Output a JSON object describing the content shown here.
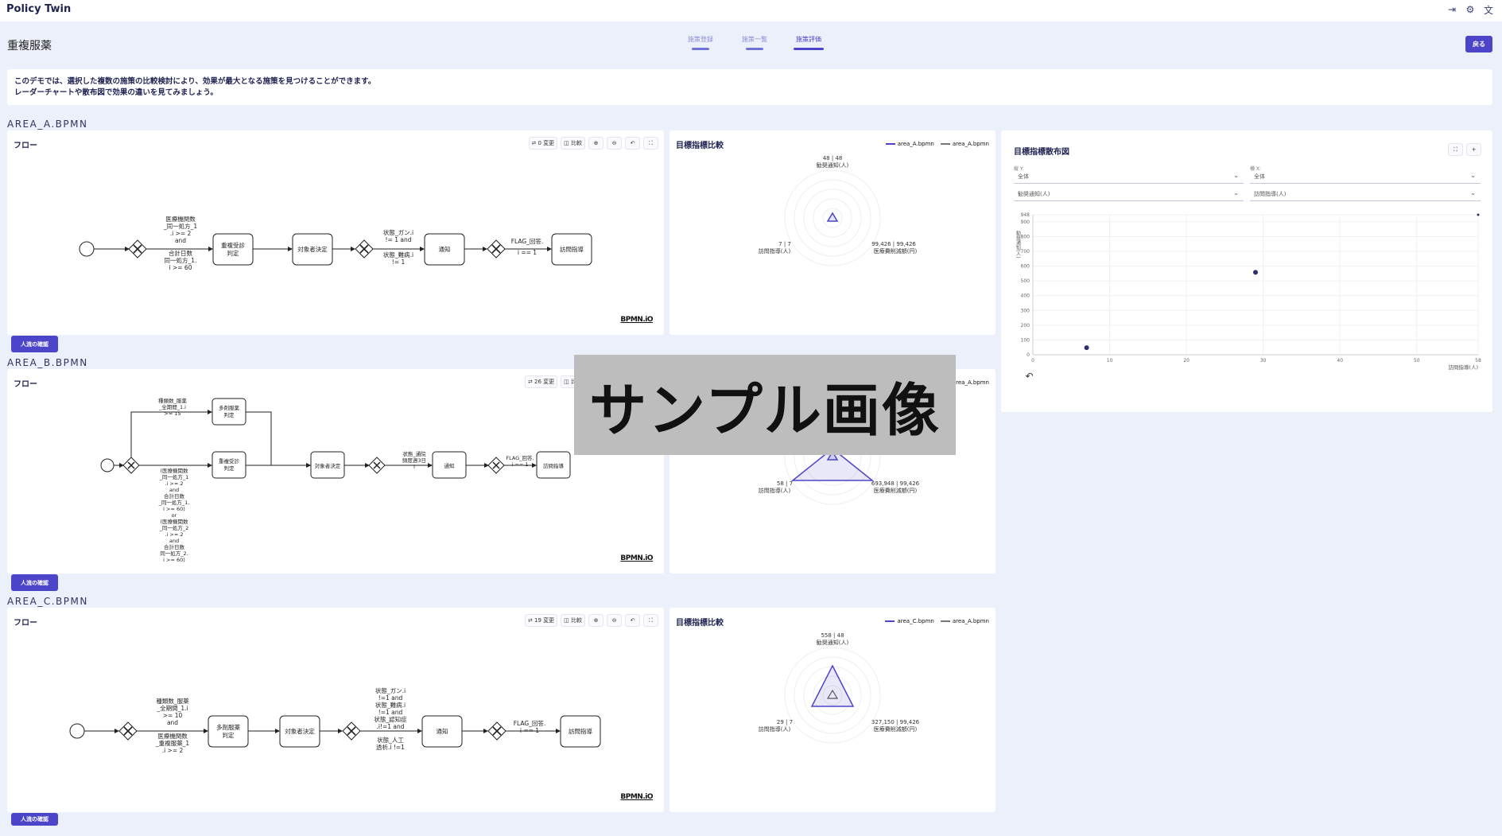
{
  "app": {
    "title": "Policy Twin"
  },
  "page": {
    "title": "重複服薬",
    "back_label": "戻る"
  },
  "steps": [
    {
      "label": "施策登録",
      "active": false
    },
    {
      "label": "施策一覧",
      "active": false
    },
    {
      "label": "施策評価",
      "active": true
    }
  ],
  "info": {
    "line1": "このデモでは、選択した複数の施策の比較検討により、効果が最大となる施策を見つけることができます。",
    "line2": "レーダーチャートや散布図で効果の違いを見てみましょう。"
  },
  "common": {
    "flow_title": "フロー",
    "compare_label": "比較",
    "bpmn_logo": "BPMN.iO",
    "check_button": "人流の確認",
    "radar_title": "目標指標比較",
    "scatter_title": "目標指標散布図"
  },
  "sections": [
    {
      "label": "AREA_A.BPMN",
      "change_count": "0 変更",
      "legend": [
        "area_A.bpmn",
        "area_A.bpmn"
      ],
      "radar": {
        "top": "48 | 48",
        "top_label": "勧奨通知(人)",
        "left": "7 | 7",
        "left_label": "訪問指導(人)",
        "right": "99,426 | 99,426",
        "right_label": "医療費削減額(円)"
      },
      "flow": {
        "gateway_cond1": [
          "医療機関数",
          "_同一処方_1",
          ".i >= 2",
          "and",
          "合計日数",
          "同一処方_1.",
          "i >= 60"
        ],
        "task1": [
          "重複受診",
          "判定"
        ],
        "task2": "対象者決定",
        "gateway_cond2": [
          "状態_ガン.i",
          "!= 1 and",
          "状態_難病.i",
          "!= 1"
        ],
        "task3": "通知",
        "gateway_cond3": [
          "FLAG_回答.",
          "i == 1"
        ],
        "task4": "訪問指導"
      }
    },
    {
      "label": "AREA_B.BPMN",
      "change_count": "26 変更",
      "legend": [
        "area_A.bpmn"
      ],
      "radar": {
        "left": "58 | 7",
        "left_label": "訪問指導(人)",
        "right": "693,948 | 99,426",
        "right_label": "医療費削減額(円)"
      },
      "flow": {
        "upper_cond": [
          "種類数_服薬",
          "_全期間_1.i",
          ">= 15"
        ],
        "upper_task": [
          "多剤服薬",
          "判定"
        ],
        "lower_task": [
          "重複受診",
          "判定"
        ],
        "lower_cond": [
          "(医療機関数",
          "_同一処方_1",
          ".i >= 2",
          "and",
          "合計日数",
          "_同一処方_1.",
          "i >= 60)",
          "or",
          "(医療機関数",
          "_同一処方_2",
          ".i >= 2",
          "and",
          "合計日数",
          "同一処方_2.",
          "i >= 60)"
        ],
        "task2": "対象者決定",
        "gateway_cond2": [
          "状態_通院",
          "頻度週3日",
          "l"
        ],
        "task3": "通知",
        "gateway_cond3": [
          "FLAG_回答.",
          "i == 1"
        ],
        "task4": "訪問指導"
      }
    },
    {
      "label": "AREA_C.BPMN",
      "change_count": "19 変更",
      "legend": [
        "area_C.bpmn",
        "area_A.bpmn"
      ],
      "radar": {
        "top": "558 | 48",
        "top_label": "勧奨通知(人)",
        "left": "29 | 7",
        "left_label": "訪問指導(人)",
        "right": "327,150 | 99,426",
        "right_label": "医療費削減額(円)"
      },
      "flow": {
        "gateway_cond1": [
          "種類数_服薬",
          "_全期間_1.i",
          ">= 10",
          "and",
          "医療機関数",
          "_重複服薬_1",
          ".i >= 2"
        ],
        "task1": [
          "多剤服薬",
          "判定"
        ],
        "task2": "対象者決定",
        "gateway_cond2": [
          "状態_ガン.i",
          "!=1 and",
          "状態_難病.i",
          "!=1 and",
          "状態_認知症",
          ".i!=1 and",
          "状態_人工",
          "透析.i !=1"
        ],
        "task3": "通知",
        "gateway_cond3": [
          "FLAG_回答.",
          "i == 1"
        ],
        "task4": "訪問指導"
      }
    }
  ],
  "scatter": {
    "ylabel_select_label": "縦 Y:",
    "xlabel_select_label": "横 X:",
    "y_filter": "全体",
    "x_filter": "全体",
    "y_metric": "勧奨通知(人)",
    "x_metric": "訪問指導(人)",
    "ylabel": "勧奨通知(人)",
    "xlabel": "訪問指導(人)"
  },
  "chart_data": {
    "type": "scatter",
    "title": "目標指標散布図",
    "xlabel": "訪問指導(人)",
    "ylabel": "勧奨通知(人)",
    "xlim": [
      0,
      58
    ],
    "ylim": [
      0,
      948
    ],
    "x_ticks": [
      0,
      10,
      20,
      30,
      40,
      50,
      58
    ],
    "y_ticks": [
      0,
      100,
      200,
      300,
      400,
      500,
      600,
      700,
      800,
      900,
      948
    ],
    "grid": true,
    "points": [
      {
        "x": 7,
        "y": 48
      },
      {
        "x": 29,
        "y": 558
      },
      {
        "x": 58,
        "y": 948
      }
    ]
  },
  "watermark": "サンプル画像",
  "colors": {
    "accent": "#4c45c9",
    "series_a": "#4c45c9",
    "series_b": "#777777"
  },
  "icons": {
    "top": [
      "logout-icon",
      "settings-icon",
      "translate-icon"
    ]
  }
}
